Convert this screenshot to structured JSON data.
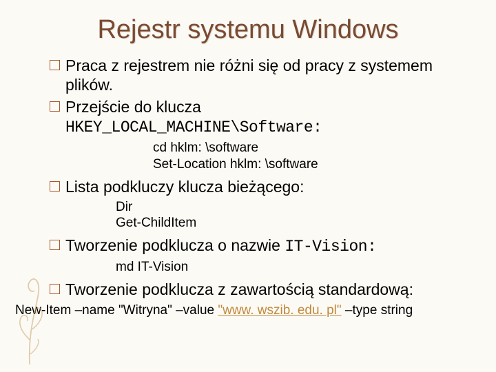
{
  "title": "Rejestr systemu Windows",
  "b1a": "Praca z rejestrem nie różni się od pracy z systemem plików.",
  "b2a": "Przejście do klucza ",
  "b2m": "HKEY_LOCAL_MACHINE\\Software:",
  "code1a": "cd hklm: \\software",
  "code1b": "Set-Location hklm: \\software",
  "b3": "Lista podkluczy klucza bieżącego:",
  "code2a": "Dir",
  "code2b": "Get-ChildItem",
  "b4a": "Tworzenie podklucza o nazwie ",
  "b4m": "IT-Vision:",
  "code3": "md IT-Vision",
  "b5": "Tworzenie podklucza z zawartością standardową:",
  "footer_pre": "New-Item –name \"Witryna\" –value ",
  "footer_link": "\"www. wszib. edu. pl\"",
  "footer_post": " –type string"
}
